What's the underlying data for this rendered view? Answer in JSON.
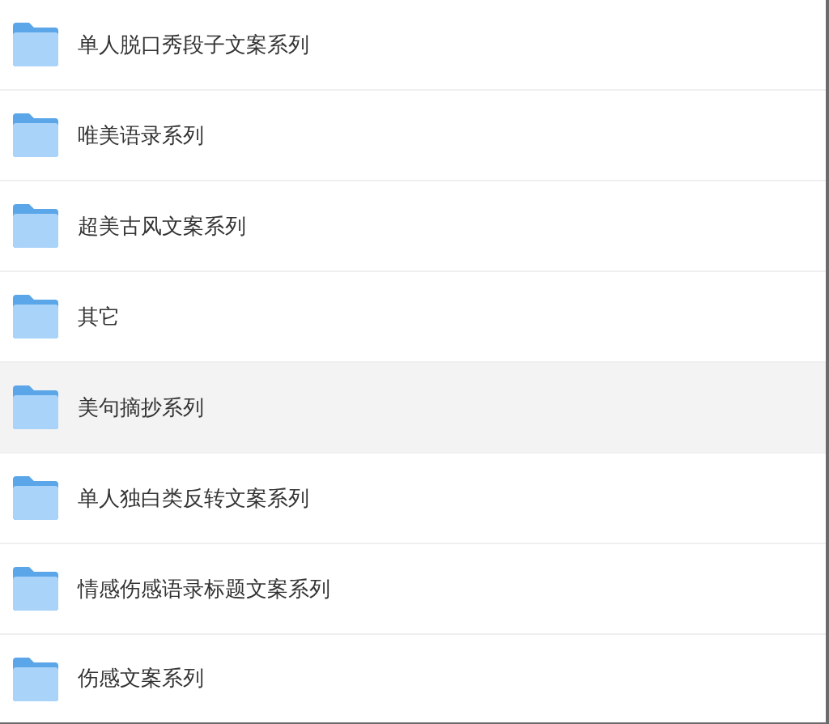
{
  "folders": [
    {
      "name": "单人脱口秀段子文案系列",
      "selected": false
    },
    {
      "name": "唯美语录系列",
      "selected": false
    },
    {
      "name": "超美古风文案系列",
      "selected": false
    },
    {
      "name": "其它",
      "selected": false
    },
    {
      "name": "美句摘抄系列",
      "selected": true
    },
    {
      "name": "单人独白类反转文案系列",
      "selected": false
    },
    {
      "name": "情感伤感语录标题文案系列",
      "selected": false
    },
    {
      "name": "伤感文案系列",
      "selected": false
    }
  ]
}
